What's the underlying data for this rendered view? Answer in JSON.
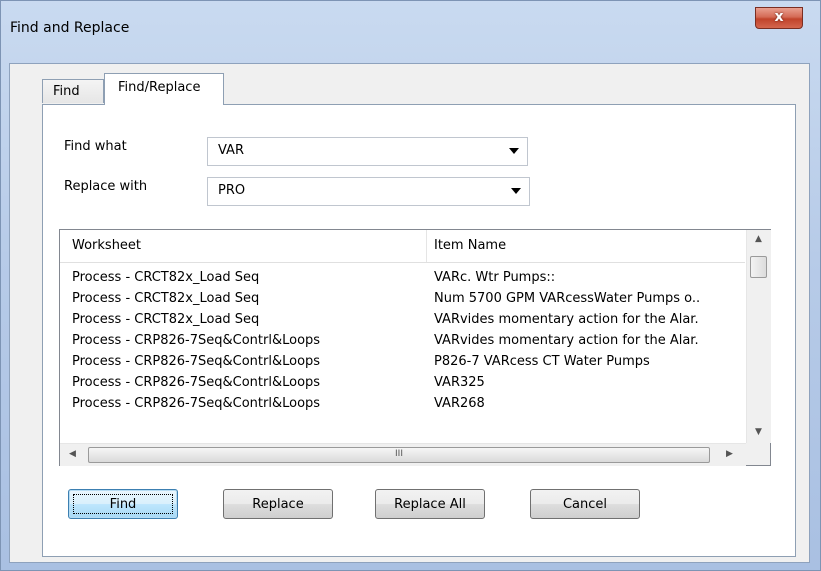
{
  "window": {
    "title": "Find and Replace",
    "close_label": "x"
  },
  "tabs": [
    {
      "label": "Find"
    },
    {
      "label": "Find/Replace"
    }
  ],
  "form": {
    "find_what_label": "Find what",
    "find_what_value": "VAR",
    "replace_with_label": "Replace with",
    "replace_with_value": "PRO"
  },
  "list": {
    "columns": [
      "Worksheet",
      "Item Name"
    ],
    "rows": [
      {
        "worksheet": "Process - CRCT82x_Load Seq",
        "item": "VARc. Wtr Pumps::"
      },
      {
        "worksheet": "Process - CRCT82x_Load Seq",
        "item": "Num 5700 GPM VARcessWater Pumps o.."
      },
      {
        "worksheet": "Process - CRCT82x_Load Seq",
        "item": "VARvides momentary action for the Alar."
      },
      {
        "worksheet": "Process - CRP826-7Seq&Contrl&Loops",
        "item": "VARvides momentary action for the Alar."
      },
      {
        "worksheet": "Process - CRP826-7Seq&Contrl&Loops",
        "item": "P826-7 VARcess CT Water Pumps"
      },
      {
        "worksheet": "Process - CRP826-7Seq&Contrl&Loops",
        "item": "VAR325"
      },
      {
        "worksheet": "Process - CRP826-7Seq&Contrl&Loops",
        "item": "VAR268"
      }
    ],
    "hscroll_grip": "III"
  },
  "buttons": {
    "find": "Find",
    "replace": "Replace",
    "replace_all": "Replace All",
    "cancel": "Cancel"
  }
}
